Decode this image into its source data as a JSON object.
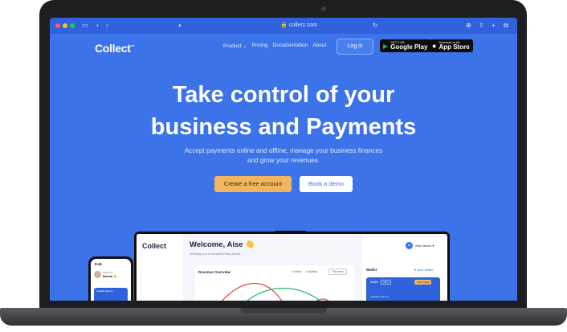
{
  "browser": {
    "url": "collect.com"
  },
  "nav": {
    "logo": "Collect",
    "logo_mark": "™",
    "links": [
      "Product",
      "Pricing",
      "Documentation",
      "About"
    ],
    "login": "Log in",
    "google_play_small": "GET IT ON",
    "google_play": "Google Play",
    "app_store_small": "Download on the",
    "app_store": "App Store"
  },
  "hero": {
    "headline_line1": "Take control of your",
    "headline_line2": "business and Payments",
    "subtitle": "Accept payments online and offline, manage your business finances and grow your revenues.",
    "cta_primary": "Create a free account",
    "cta_secondary": "Book a demo"
  },
  "dashboard": {
    "logo": "Collect",
    "welcome": "Welcome, Aise 👋",
    "welcome_sub": "Wishing you a wonderful day ahead",
    "user": "Aise Idahor",
    "avatar": "AI",
    "revenue_title": "Revenue Overview",
    "legend_inflow": "Inflow",
    "legend_outflow": "Outflow",
    "period": "This Year",
    "wallet_title": "Wallet",
    "new_wallet": "New Wallet",
    "wallet_label": "Wallet",
    "wallet_currency": "NGN",
    "wallet_btn": "Fund wallet",
    "wallet_footer": "Available Balance"
  },
  "phone": {
    "time": "9:41",
    "welcome": "Welcome",
    "name": "Devon 👋",
    "balance_label": "Available Balance"
  },
  "colors": {
    "hero_blue": "#3c73e9",
    "cta": "#f3b45f",
    "laptop": "#1d1e20"
  }
}
